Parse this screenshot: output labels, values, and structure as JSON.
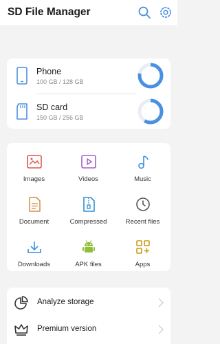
{
  "header": {
    "title": "SD File Manager",
    "search_icon": "search-icon",
    "settings_icon": "settings-icon"
  },
  "colors": {
    "accent": "#4a90e2",
    "ring_track": "#e9eef4",
    "images": "#e0544e",
    "videos": "#a35ec9",
    "music": "#3b8fe0",
    "document": "#d4924a",
    "compressed": "#2f8fd0",
    "recent": "#555555",
    "downloads": "#3b8fe0",
    "apk": "#8fbf3a",
    "apps": "#c99b18"
  },
  "storage": [
    {
      "name": "Phone",
      "size": "100 GB / 128 GB",
      "icon": "phone-icon",
      "used_fraction": 0.78
    },
    {
      "name": "SD card",
      "size": "150 GB / 256 GB",
      "icon": "sd-card-icon",
      "used_fraction": 0.59
    }
  ],
  "categories": [
    {
      "label": "Images",
      "icon": "images-icon"
    },
    {
      "label": "Videos",
      "icon": "videos-icon"
    },
    {
      "label": "Music",
      "icon": "music-icon"
    },
    {
      "label": "Document",
      "icon": "document-icon"
    },
    {
      "label": "Compressed",
      "icon": "compressed-icon"
    },
    {
      "label": "Recent files",
      "icon": "recent-files-icon"
    },
    {
      "label": "Downloads",
      "icon": "downloads-icon"
    },
    {
      "label": "APK files",
      "icon": "apk-icon"
    },
    {
      "label": "Apps",
      "icon": "apps-icon"
    }
  ],
  "menu": [
    {
      "label": "Analyze storage",
      "icon": "pie-chart-icon"
    },
    {
      "label": "Premium version",
      "icon": "crown-icon"
    }
  ]
}
